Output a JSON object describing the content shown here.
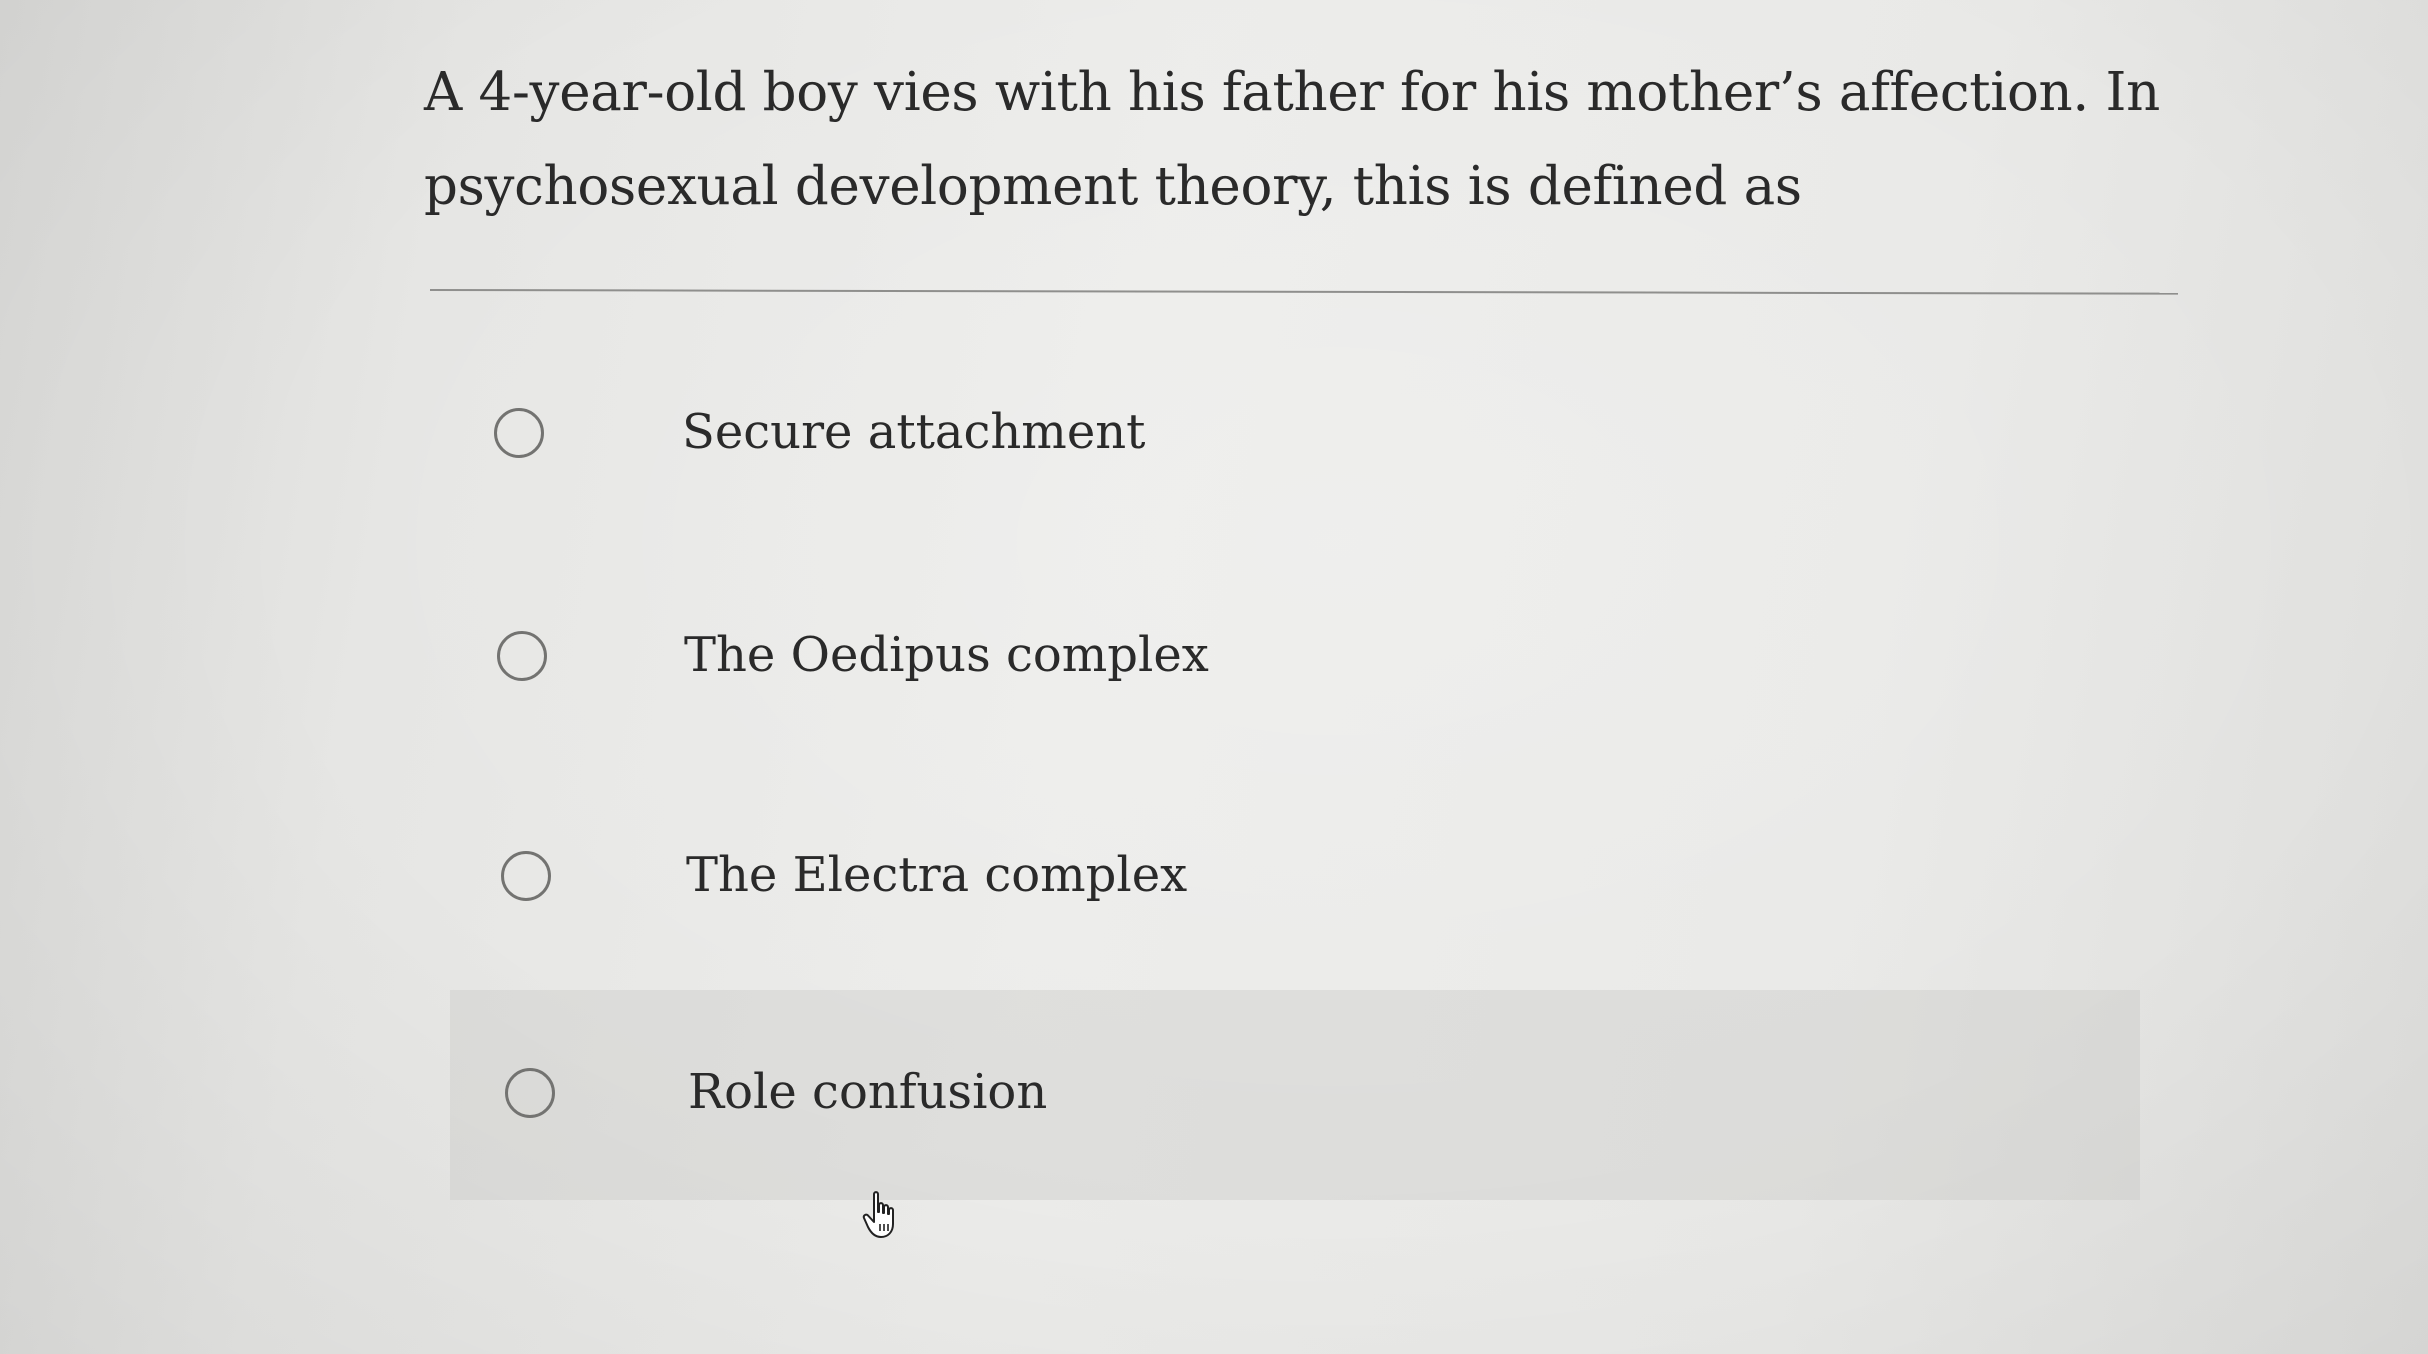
{
  "question": {
    "text": "A 4-year-old boy vies with his father for his mother’s affection. In psychosexual development theory, this is defined as"
  },
  "options": [
    {
      "label": "Secure attachment",
      "selected": false
    },
    {
      "label": "The Oedipus complex",
      "selected": false
    },
    {
      "label": "The Electra complex",
      "selected": false
    },
    {
      "label": "Role confusion",
      "selected": false,
      "hovered": true
    }
  ],
  "icons": {
    "cursor": "hand-pointer-icon",
    "radio": "radio-button-unchecked-icon"
  },
  "colors": {
    "background": "#e8e8e6",
    "text": "#2a2a2a",
    "radio_border": "#737371",
    "hover_highlight": "#d6d6d4"
  }
}
